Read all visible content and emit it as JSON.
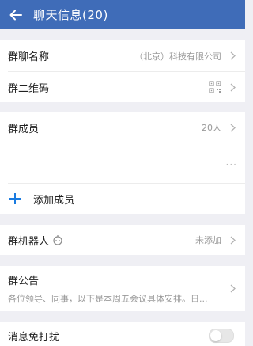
{
  "header": {
    "title": "聊天信息(20)",
    "back_icon": "back-arrow-icon",
    "bg_color": "#3f6cb8"
  },
  "group_info": {
    "name_label": "群聊名称",
    "name_value": "（北京）科技有限公司",
    "qr_label": "群二维码",
    "qr_icon": "qr-code-icon"
  },
  "members": {
    "label": "群成员",
    "count": "20人",
    "more": "···",
    "add_label": "添加成员",
    "add_icon": "plus-icon",
    "accent_color": "#1a7be0"
  },
  "robot": {
    "label": "群机器人",
    "icon": "robot-icon",
    "status": "未添加"
  },
  "notice": {
    "label": "群公告",
    "preview": "各位领导、同事，以下是本周五会议具体安排。日..."
  },
  "partial_row": {
    "label": "消息免打扰",
    "toggle_on": false
  }
}
